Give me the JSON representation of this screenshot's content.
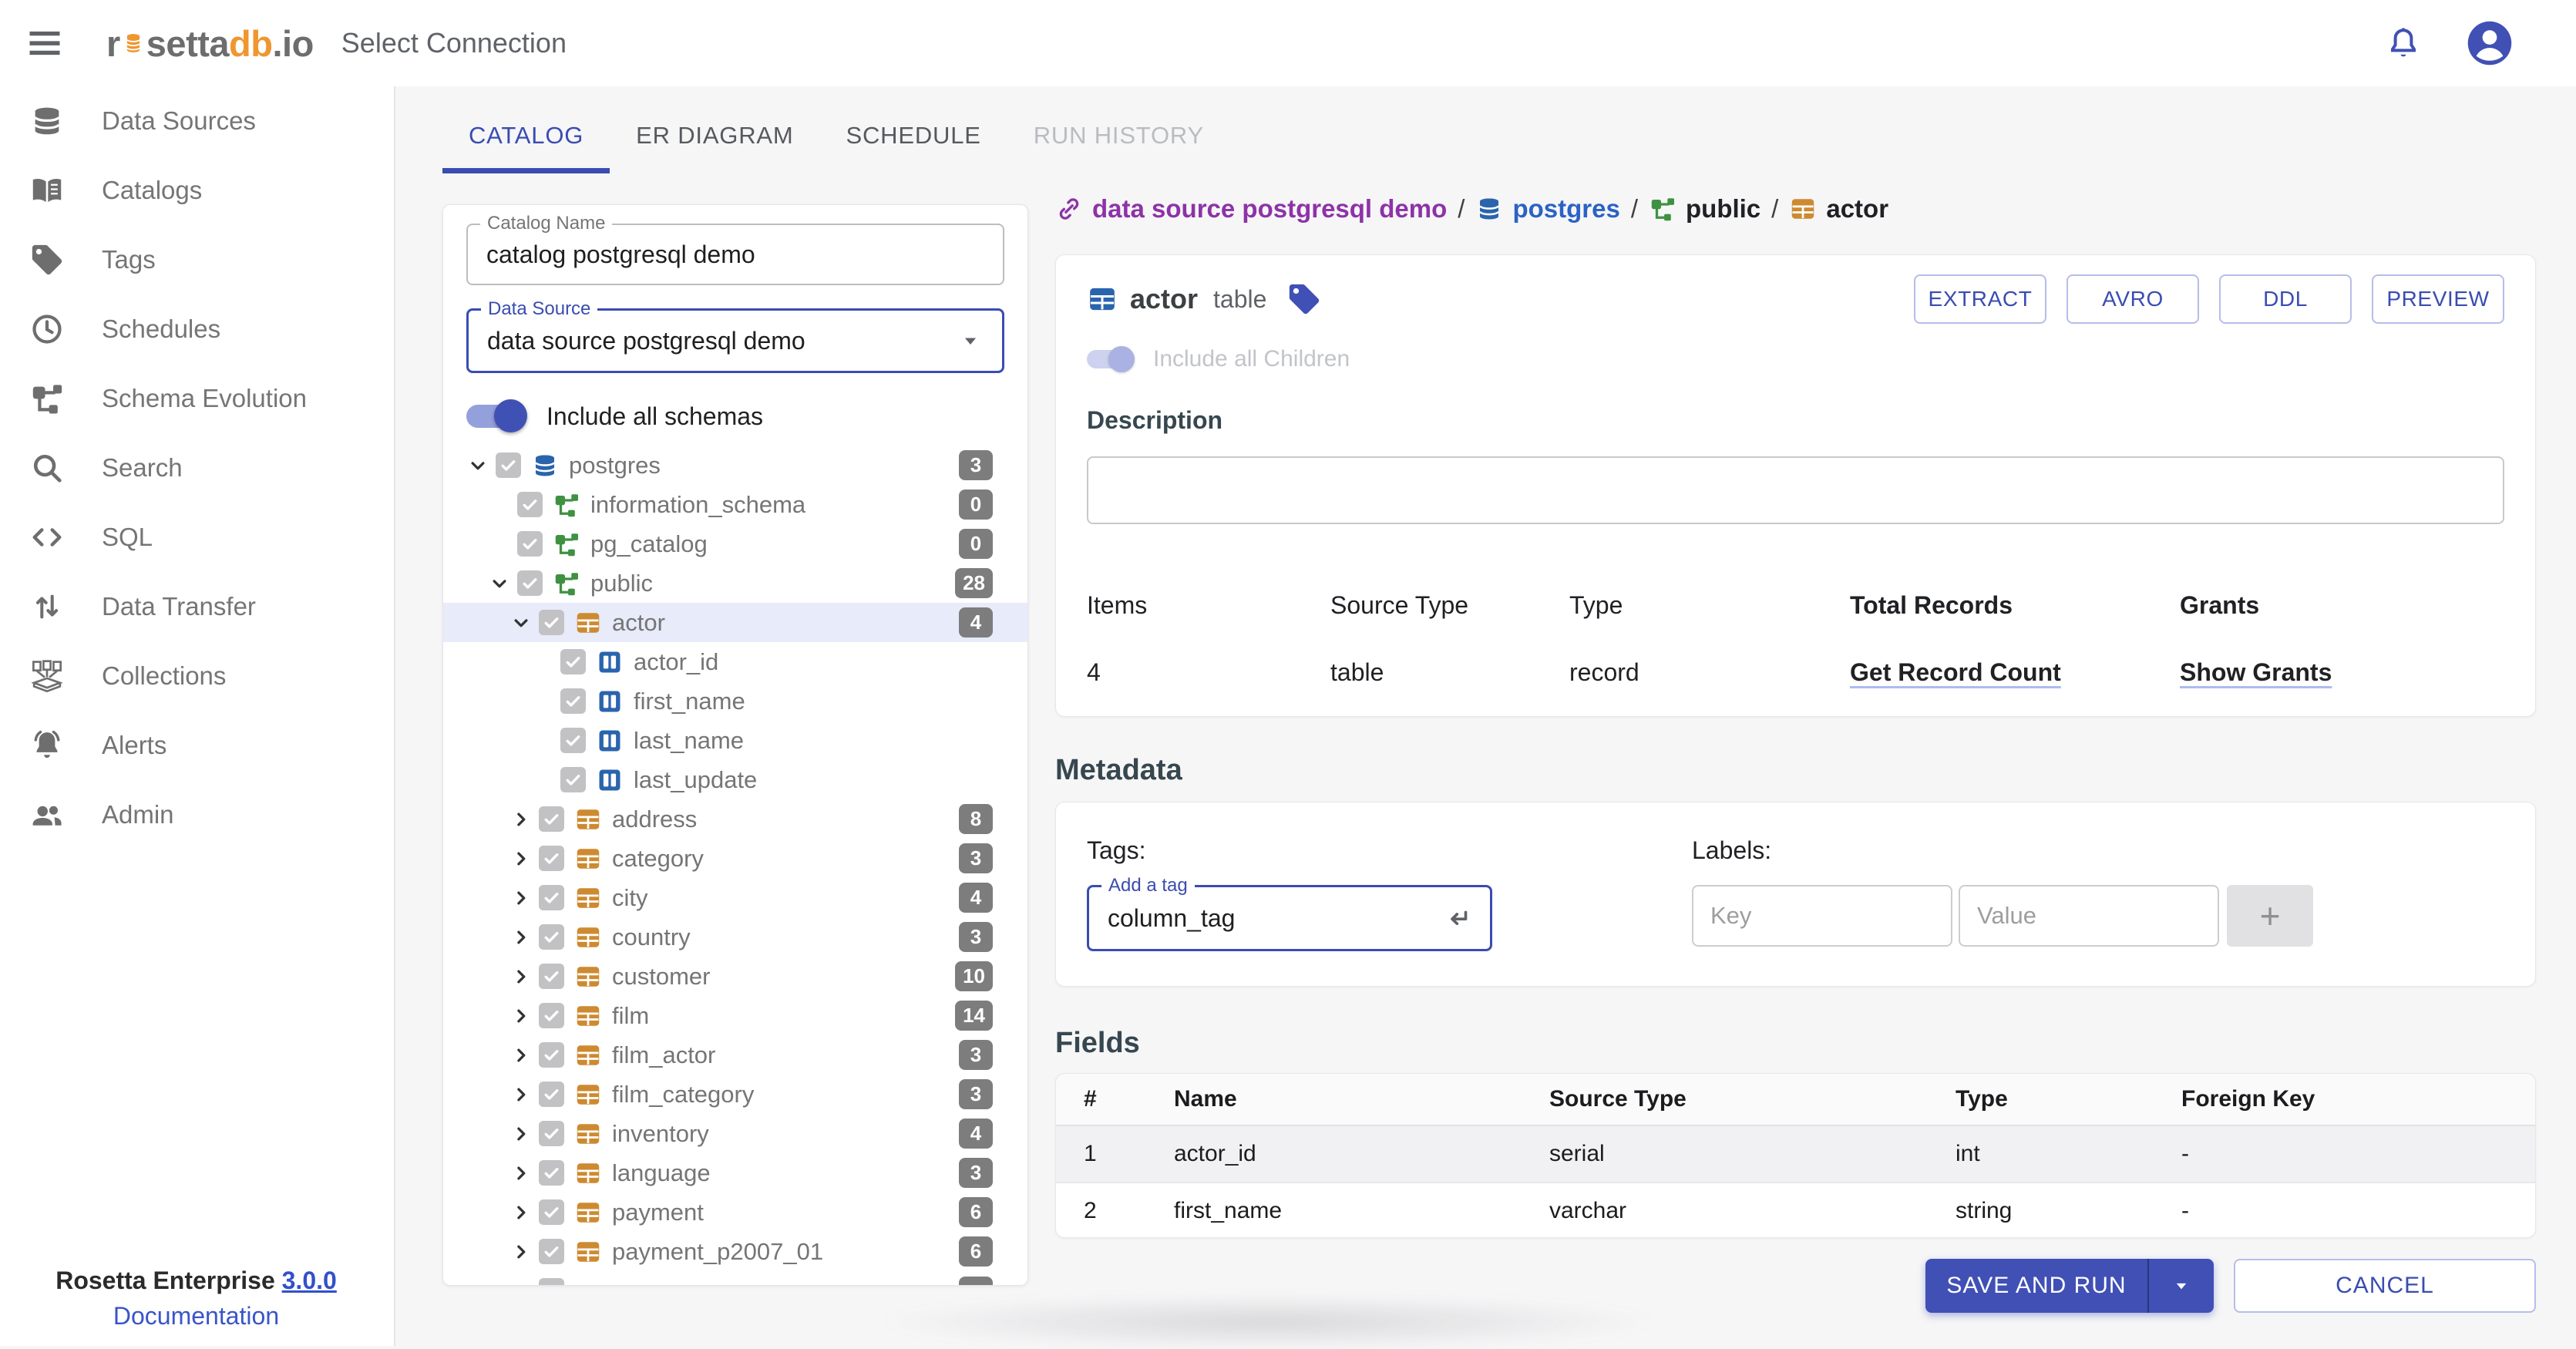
{
  "topbar": {
    "logo": {
      "pre": "r",
      "mid": "setta",
      "accent": "db",
      "suffix": ".io"
    },
    "title": "Select Connection"
  },
  "sidebar": {
    "items": [
      {
        "label": "Data Sources",
        "icon": "database"
      },
      {
        "label": "Catalogs",
        "icon": "book"
      },
      {
        "label": "Tags",
        "icon": "tag"
      },
      {
        "label": "Schedules",
        "icon": "clock"
      },
      {
        "label": "Schema Evolution",
        "icon": "schema"
      },
      {
        "label": "Search",
        "icon": "search"
      },
      {
        "label": "SQL",
        "icon": "code"
      },
      {
        "label": "Data Transfer",
        "icon": "transfer"
      },
      {
        "label": "Collections",
        "icon": "collections"
      },
      {
        "label": "Alerts",
        "icon": "bell"
      },
      {
        "label": "Admin",
        "icon": "people"
      }
    ],
    "footer": {
      "product": "Rosetta Enterprise",
      "version": "3.0.0",
      "doc_link": "Documentation"
    }
  },
  "tabs": [
    {
      "label": "CATALOG",
      "state": "active"
    },
    {
      "label": "ER DIAGRAM",
      "state": "default"
    },
    {
      "label": "SCHEDULE",
      "state": "default"
    },
    {
      "label": "RUN HISTORY",
      "state": "disabled"
    }
  ],
  "catalog_panel": {
    "catalog_name_label": "Catalog Name",
    "catalog_name_value": "catalog postgresql demo",
    "data_source_label": "Data Source",
    "data_source_value": "data source postgresql demo",
    "include_all_schemas_label": "Include all schemas",
    "tree": [
      {
        "label": "postgres",
        "badge": "3",
        "icon": "database",
        "level": 0,
        "chevron": "down",
        "checked": true,
        "selected": false
      },
      {
        "label": "information_schema",
        "badge": "0",
        "icon": "schema",
        "level": 1,
        "chevron": "none",
        "checked": true,
        "selected": false
      },
      {
        "label": "pg_catalog",
        "badge": "0",
        "icon": "schema",
        "level": 1,
        "chevron": "none",
        "checked": true,
        "selected": false
      },
      {
        "label": "public",
        "badge": "28",
        "icon": "schema",
        "level": 1,
        "chevron": "down",
        "checked": true,
        "selected": false
      },
      {
        "label": "actor",
        "badge": "4",
        "icon": "table",
        "level": 2,
        "chevron": "down",
        "checked": true,
        "selected": true
      },
      {
        "label": "actor_id",
        "badge": null,
        "icon": "column",
        "level": 3,
        "chevron": "none",
        "checked": true,
        "selected": false
      },
      {
        "label": "first_name",
        "badge": null,
        "icon": "column",
        "level": 3,
        "chevron": "none",
        "checked": true,
        "selected": false
      },
      {
        "label": "last_name",
        "badge": null,
        "icon": "column",
        "level": 3,
        "chevron": "none",
        "checked": true,
        "selected": false
      },
      {
        "label": "last_update",
        "badge": null,
        "icon": "column",
        "level": 3,
        "chevron": "none",
        "checked": true,
        "selected": false
      },
      {
        "label": "address",
        "badge": "8",
        "icon": "table",
        "level": 2,
        "chevron": "right",
        "checked": true,
        "selected": false
      },
      {
        "label": "category",
        "badge": "3",
        "icon": "table",
        "level": 2,
        "chevron": "right",
        "checked": true,
        "selected": false
      },
      {
        "label": "city",
        "badge": "4",
        "icon": "table",
        "level": 2,
        "chevron": "right",
        "checked": true,
        "selected": false
      },
      {
        "label": "country",
        "badge": "3",
        "icon": "table",
        "level": 2,
        "chevron": "right",
        "checked": true,
        "selected": false
      },
      {
        "label": "customer",
        "badge": "10",
        "icon": "table",
        "level": 2,
        "chevron": "right",
        "checked": true,
        "selected": false
      },
      {
        "label": "film",
        "badge": "14",
        "icon": "table",
        "level": 2,
        "chevron": "right",
        "checked": true,
        "selected": false
      },
      {
        "label": "film_actor",
        "badge": "3",
        "icon": "table",
        "level": 2,
        "chevron": "right",
        "checked": true,
        "selected": false
      },
      {
        "label": "film_category",
        "badge": "3",
        "icon": "table",
        "level": 2,
        "chevron": "right",
        "checked": true,
        "selected": false
      },
      {
        "label": "inventory",
        "badge": "4",
        "icon": "table",
        "level": 2,
        "chevron": "right",
        "checked": true,
        "selected": false
      },
      {
        "label": "language",
        "badge": "3",
        "icon": "table",
        "level": 2,
        "chevron": "right",
        "checked": true,
        "selected": false
      },
      {
        "label": "payment",
        "badge": "6",
        "icon": "table",
        "level": 2,
        "chevron": "right",
        "checked": true,
        "selected": false
      },
      {
        "label": "payment_p2007_01",
        "badge": "6",
        "icon": "table",
        "level": 2,
        "chevron": "right",
        "checked": true,
        "selected": false
      }
    ]
  },
  "breadcrumb": {
    "separator": "/",
    "segments": [
      {
        "label": "data source postgresql demo",
        "icon": "link",
        "color": "#8e32a8"
      },
      {
        "label": "postgres",
        "icon": "database",
        "color": "#2a63c4"
      },
      {
        "label": "public",
        "icon": "schema",
        "color": "#202124"
      },
      {
        "label": "actor",
        "icon": "table",
        "color": "#202124"
      }
    ]
  },
  "detail": {
    "entity_name": "actor",
    "entity_type": "table",
    "actions": [
      "EXTRACT",
      "AVRO",
      "DDL",
      "PREVIEW"
    ],
    "include_children_label": "Include all Children",
    "description_label": "Description",
    "description_value": "",
    "stats": {
      "items_label": "Items",
      "items_value": "4",
      "source_type_label": "Source Type",
      "source_type_value": "table",
      "type_label": "Type",
      "type_value": "record",
      "total_records_label": "Total Records",
      "total_records_link": "Get Record Count",
      "grants_label": "Grants",
      "grants_link": "Show Grants"
    },
    "metadata": {
      "heading": "Metadata",
      "tags_label": "Tags:",
      "add_tag_label": "Add a tag",
      "tag_value": "column_tag",
      "labels_label": "Labels:",
      "key_placeholder": "Key",
      "value_placeholder": "Value",
      "add_label_button": "+"
    },
    "fields": {
      "heading": "Fields",
      "columns": [
        "#",
        "Name",
        "Source Type",
        "Type",
        "Foreign Key"
      ],
      "rows": [
        [
          "1",
          "actor_id",
          "serial",
          "int",
          "-"
        ],
        [
          "2",
          "first_name",
          "varchar",
          "string",
          "-"
        ]
      ]
    },
    "footer_actions": {
      "save_and_run": "SAVE AND RUN",
      "cancel": "CANCEL"
    }
  },
  "colors": {
    "primary": "#3f51b5",
    "accent_orange": "#f0962f",
    "link_blue": "#3350cb",
    "breadcrumb_purple": "#8e32a8",
    "breadcrumb_blue": "#2a63c4",
    "icon_db_blue": "#2a64ad",
    "icon_schema_green": "#3f9142",
    "icon_table_orange": "#cd8a31",
    "badge_gray": "#7d7d7d",
    "selected_row": "#e7ebfa"
  }
}
